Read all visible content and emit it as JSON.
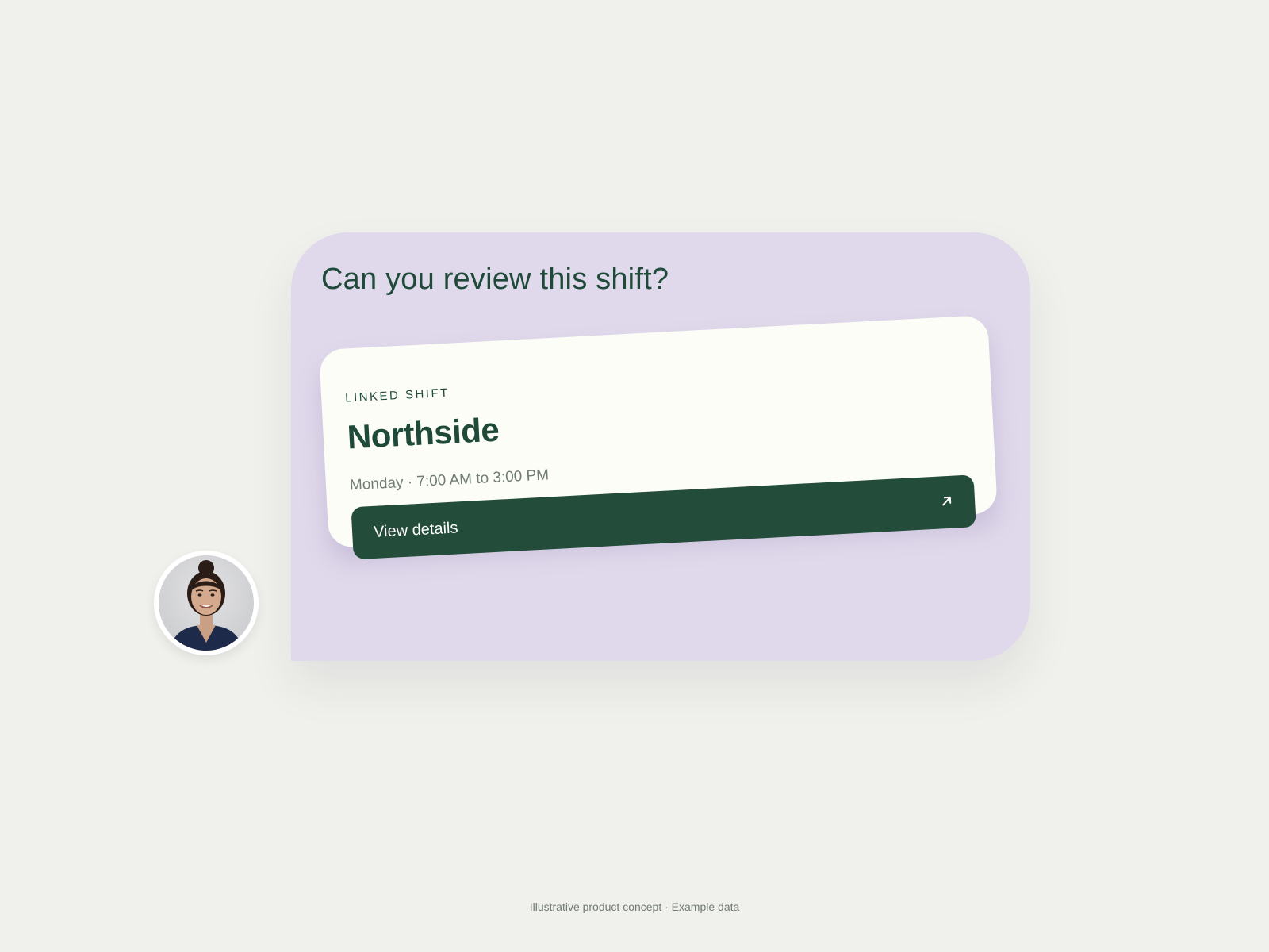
{
  "message": {
    "title": "Can you review this shift?"
  },
  "shift_card": {
    "eyebrow": "LINKED SHIFT",
    "location": "Northside",
    "time": "Monday · 7:00 AM to 3:00 PM",
    "button_label": "View details",
    "button_icon": "arrow-up-right-icon"
  },
  "sender": {
    "avatar": "avatar-photo"
  },
  "footer": {
    "caption": "Illustrative product concept · Example data"
  },
  "colors": {
    "background": "#f0f1ec",
    "bubble": "#e0d9eb",
    "card": "#fdfdf7",
    "accent_green": "#244c3a",
    "text_green": "#1f4a3a"
  }
}
